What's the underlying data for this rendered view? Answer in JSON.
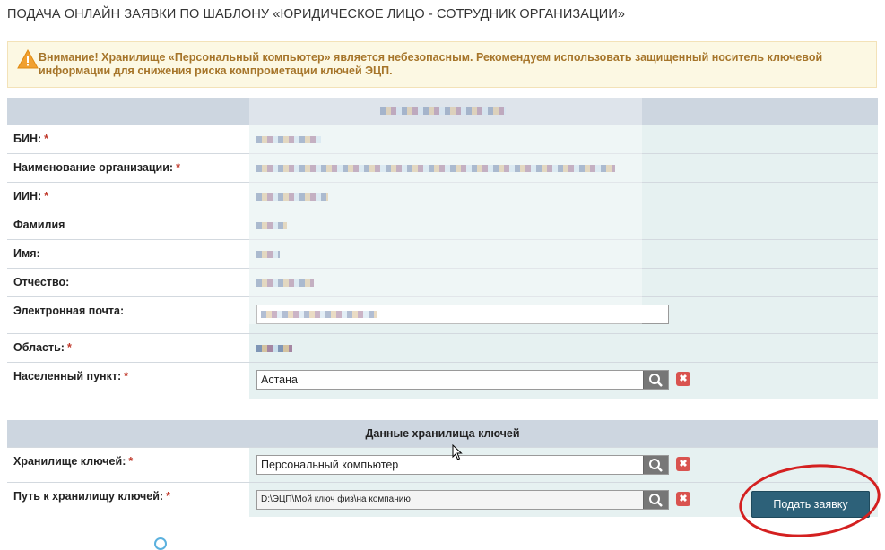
{
  "page_title": "ПОДАЧА ОНЛАЙН ЗАЯВКИ ПО ШАБЛОНУ «ЮРИДИЧЕСКОЕ ЛИЦО - СОТРУДНИК ОРГАНИЗАЦИИ»",
  "alert": {
    "icon": "warning-icon",
    "text": "Внимание! Хранилище «Персональный компьютер» является небезопасным. Рекомендуем использовать защищенный носитель ключевой информации для снижения риска компрометации ключей ЭЦП."
  },
  "org_section": {
    "fields": [
      {
        "label": "БИН:",
        "required": "*"
      },
      {
        "label": "Наименование организации:",
        "required": "*"
      },
      {
        "label": "ИИН:",
        "required": "*"
      },
      {
        "label": "Фамилия",
        "required": ""
      },
      {
        "label": "Имя:",
        "required": ""
      },
      {
        "label": "Отчество:",
        "required": ""
      },
      {
        "label": "Электронная почта:",
        "required": ""
      },
      {
        "label": "Область:",
        "required": "*"
      },
      {
        "label": "Населенный пункт:",
        "required": "*",
        "value": "Астана"
      }
    ]
  },
  "key_section": {
    "title": "Данные хранилища ключей",
    "storage_label": "Хранилище ключей:",
    "storage_required": "*",
    "storage_value": "Персональный компьютер",
    "path_label": "Путь к хранилищу ключей:",
    "path_required": "*",
    "path_value": "D:\\ЭЦП\\Мой ключ физ\\на компанию"
  },
  "actions": {
    "submit_label": "Подать заявку"
  },
  "icons": {
    "search": "search-icon",
    "clear": "close-icon",
    "clear_glyph": "✖"
  },
  "colors": {
    "alert_text": "#a6752a",
    "section_header": "#cdd6e0",
    "value_cell": "#e6f1f1",
    "submit_bg": "#2d6179",
    "annotation_circle": "#d42020"
  }
}
